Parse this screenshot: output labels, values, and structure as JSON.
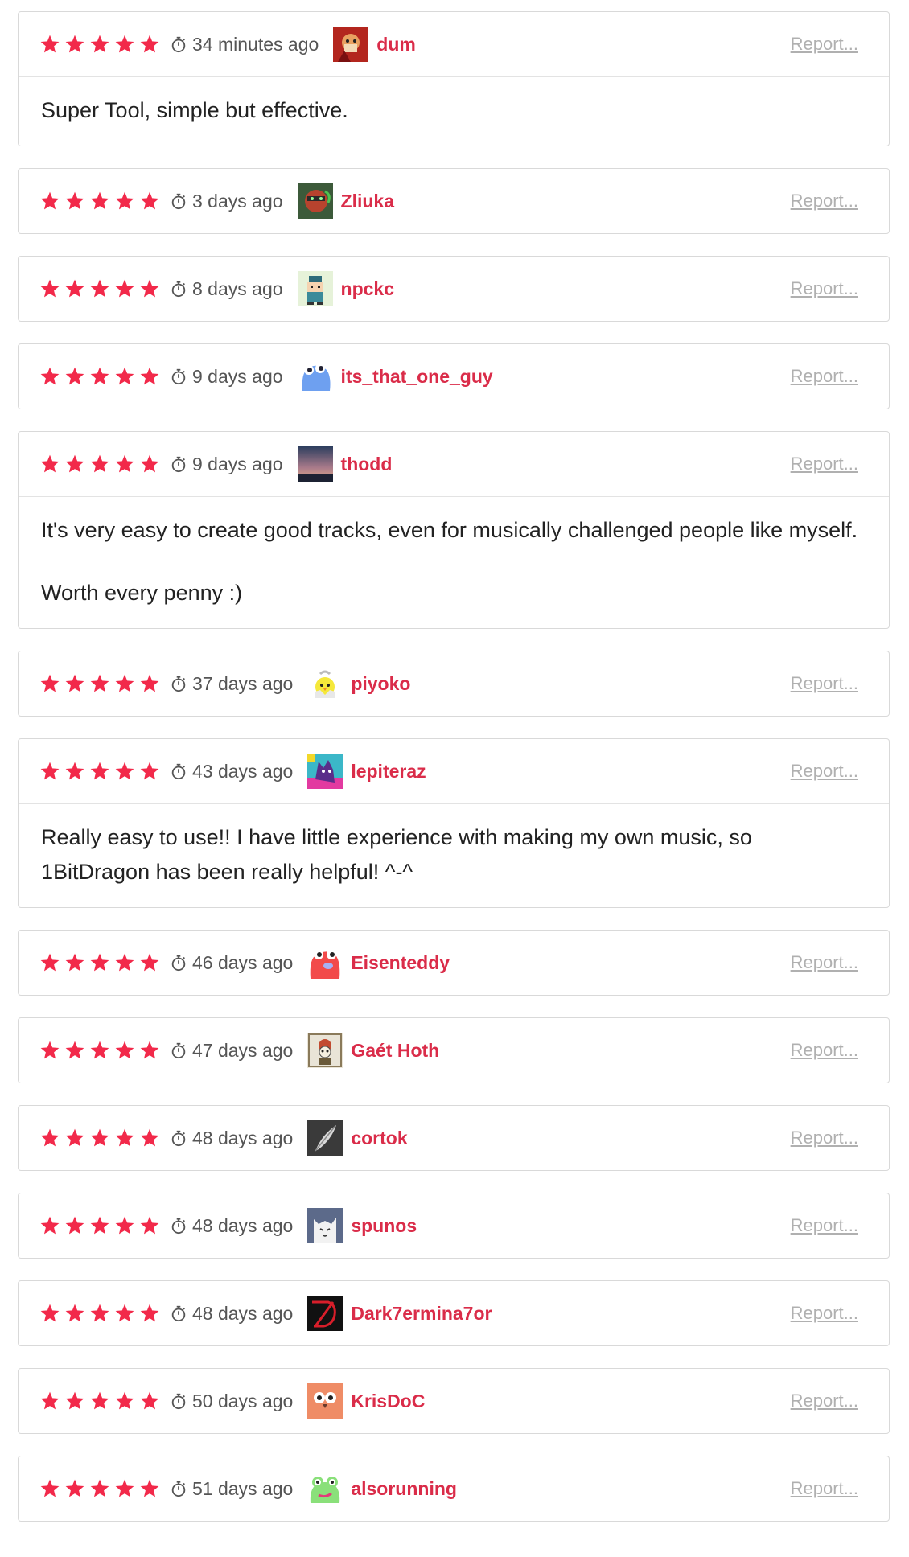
{
  "rating": 5,
  "report_label": "Report...",
  "colors": {
    "star": "#f2294a",
    "username": "#da2c49",
    "report": "#b0b0b0"
  },
  "reviews": [
    {
      "time": "34 minutes ago",
      "user": "dum",
      "avatar": "fox-avatar",
      "body": [
        "Super Tool, simple but effective."
      ]
    },
    {
      "time": "3 days ago",
      "user": "Zliuka",
      "avatar": "green-creature-avatar",
      "body": []
    },
    {
      "time": "8 days ago",
      "user": "npckc",
      "avatar": "pixel-character-avatar",
      "body": []
    },
    {
      "time": "9 days ago",
      "user": "its_that_one_guy",
      "avatar": "blue-blob-avatar",
      "body": []
    },
    {
      "time": "9 days ago",
      "user": "thodd",
      "avatar": "sunset-avatar",
      "body": [
        "It's very easy to create good tracks, even for musically challenged people like myself.",
        "Worth every penny :)"
      ]
    },
    {
      "time": "37 days ago",
      "user": "piyoko",
      "avatar": "chick-avatar",
      "body": []
    },
    {
      "time": "43 days ago",
      "user": "lepiteraz",
      "avatar": "purple-cat-avatar",
      "body": [
        "Really easy to use!! I have little experience with making my own music, so 1BitDragon has been really helpful! ^-^"
      ]
    },
    {
      "time": "46 days ago",
      "user": "Eisenteddy",
      "avatar": "red-blob-avatar",
      "body": []
    },
    {
      "time": "47 days ago",
      "user": "Gaét Hoth",
      "avatar": "skull-portrait-avatar",
      "body": []
    },
    {
      "time": "48 days ago",
      "user": "cortok",
      "avatar": "feather-avatar",
      "body": []
    },
    {
      "time": "48 days ago",
      "user": "spunos",
      "avatar": "white-cat-avatar",
      "body": []
    },
    {
      "time": "48 days ago",
      "user": "Dark7ermina7or",
      "avatar": "red-d-logo-avatar",
      "body": []
    },
    {
      "time": "50 days ago",
      "user": "KrisDoC",
      "avatar": "orange-owl-avatar",
      "body": []
    },
    {
      "time": "51 days ago",
      "user": "alsorunning",
      "avatar": "green-frog-avatar",
      "body": []
    }
  ]
}
